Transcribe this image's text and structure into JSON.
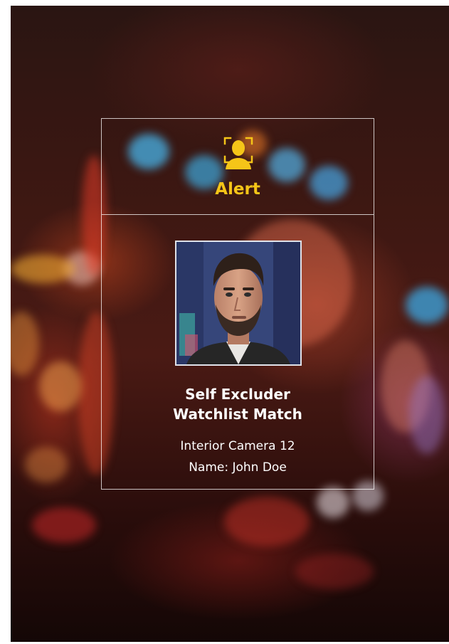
{
  "alert": {
    "title": "Alert",
    "icon": "face-scan-icon",
    "accent_color": "#f5c518"
  },
  "match": {
    "title_line1": "Self Excluder",
    "title_line2": "Watchlist Match",
    "camera": "Interior Camera 12",
    "name": "Name: John Doe"
  },
  "photo": {
    "subject": "portrait-photo"
  }
}
